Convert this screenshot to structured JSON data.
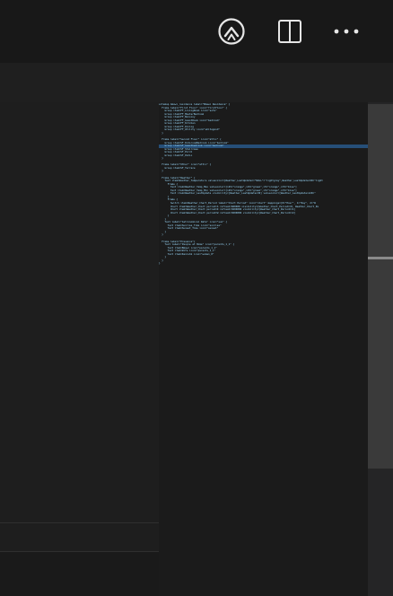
{
  "titlebar": {
    "icons": [
      "copilot-icon",
      "split-editor-icon",
      "more-actions-icon"
    ]
  },
  "code_lines": [
    "sitemap bmawi_residence label=\"Bmawi Residence\" {",
    "  Frame label=\"First Floor\" icon=\"firstfloor\" {",
    "    Group item=FF_LivingRoom icon=\"sofa\"",
    "    Group item=FF_MasterBedroom",
    "    Group item=FF_Balcony",
    "    Group item=FF_GuestRoom icon=\"bedroom\"",
    "    Group item=FF_Kitchen",
    "    Group item=FF_Dining",
    "    Group item=FF_Utility icon=\"whitegood\"",
    "  }",
    "",
    "  Frame label=\"Second Floor\" icon=\"attic\" {",
    "    Group item=SF_KidsroomBedroom icon=\"bedroom\"",
    "    Group item=SF_Guestbedroom icon=\"bedroom\"",
    "    Group item=SF_Staircase",
    "    Group item=SF_Porch",
    "    Group item=SF_Patio",
    "  }",
    "",
    "  Frame label=\"Other\" icon=\"attic\" {",
    "    Group item=SF_Terrace",
    "  }",
    "",
    "  Frame label=\"Weather\" {",
    "    Text item=Weather_Temperature valuecolor=[Weather_LastUpdate==\"NULL\"=\"lightgray\",Weather_LastUpdate>90=\"light",
    "      Frame {",
    "        Text item=Weather_Temp_Max valuecolor=[>25=\"orange\",>15=\"green\",>5=\"orange\",<=5=\"blue\"]",
    "        Text item=Weather_Temp_Min valuecolor=[>25=\"orange\",>15=\"green\",>5=\"orange\",<=5=\"blue\"]",
    "        Text item=Weather_LastUpdate visibility=[Weather_LastUpdate>30] valuecolor=[Weather_LastUpdate>120=\"",
    "      }",
    "      Frame {",
    "        Switch item=Weather_Chart_Period label=\"Chart Period\" icon=\"chart\" mappings=[0=\"Hour\", 1=\"Day\", 2=\"W",
    "        Chart item=Weather_Chart period=h refresh=600000 visibility=[Weather_Chart_Period==0, Weather_Chart_Pe",
    "        Chart item=Weather_Chart period=D refresh=3600000 visibility=[Weather_Chart_Period==1]",
    "        Chart item=Weather_Chart period=W refresh=3600000 visibility=[Weather_Chart_Period==2]",
    "      }",
    "    }",
    "    Text label=\"Astronomical Data\" icon=\"sun\" {",
    "      Text item=Sunrise_Time icon=\"sunrise\"",
    "      Text item=Sunset_Time icon=\"sunset\"",
    "    }",
    "  }",
    "",
    "  Frame label=\"Presence\"{",
    "    Text label=\"People at Home\" icon=\"parents_1_1\" {",
    "      Text item=Bmawi icon=\"parents_1_1\"",
    "      Text item=Wife icon=\"parents_1_1\"",
    "      Text item=Kanishk icon=\"woman_0\"",
    "    }",
    "  }",
    "}"
  ],
  "highlighted_line": 13
}
